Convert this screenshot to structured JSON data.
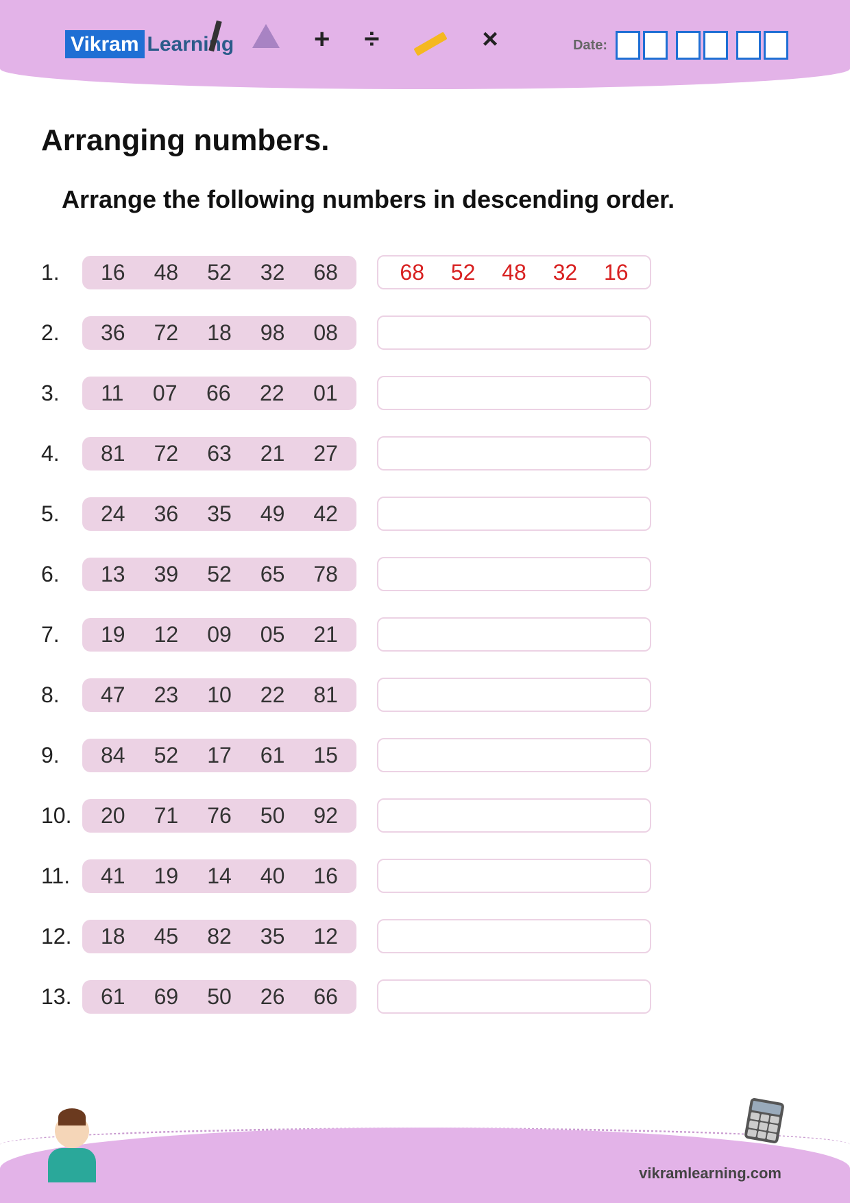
{
  "header": {
    "logo_boxed": "Vikram",
    "logo_text": "Learning",
    "date_label": "Date:",
    "symbols": {
      "plus": "+",
      "divide": "÷",
      "times": "×"
    }
  },
  "title": "Arranging numbers.",
  "subtitle": "Arrange the following numbers in descending order.",
  "problems": [
    {
      "n": "1.",
      "given": [
        "16",
        "48",
        "52",
        "32",
        "68"
      ],
      "answer": [
        "68",
        "52",
        "48",
        "32",
        "16"
      ]
    },
    {
      "n": "2.",
      "given": [
        "36",
        "72",
        "18",
        "98",
        "08"
      ],
      "answer": []
    },
    {
      "n": "3.",
      "given": [
        "11",
        "07",
        "66",
        "22",
        "01"
      ],
      "answer": []
    },
    {
      "n": "4.",
      "given": [
        "81",
        "72",
        "63",
        "21",
        "27"
      ],
      "answer": []
    },
    {
      "n": "5.",
      "given": [
        "24",
        "36",
        "35",
        "49",
        "42"
      ],
      "answer": []
    },
    {
      "n": "6.",
      "given": [
        "13",
        "39",
        "52",
        "65",
        "78"
      ],
      "answer": []
    },
    {
      "n": "7.",
      "given": [
        "19",
        "12",
        "09",
        "05",
        "21"
      ],
      "answer": []
    },
    {
      "n": "8.",
      "given": [
        "47",
        "23",
        "10",
        "22",
        "81"
      ],
      "answer": []
    },
    {
      "n": "9.",
      "given": [
        "84",
        "52",
        "17",
        "61",
        "15"
      ],
      "answer": []
    },
    {
      "n": "10.",
      "given": [
        "20",
        "71",
        "76",
        "50",
        "92"
      ],
      "answer": []
    },
    {
      "n": "11.",
      "given": [
        "41",
        "19",
        "14",
        "40",
        "16"
      ],
      "answer": []
    },
    {
      "n": "12.",
      "given": [
        "18",
        "45",
        "82",
        "35",
        "12"
      ],
      "answer": []
    },
    {
      "n": "13.",
      "given": [
        "61",
        "69",
        "50",
        "26",
        "66"
      ],
      "answer": []
    }
  ],
  "footer": {
    "url": "vikramlearning.com"
  }
}
